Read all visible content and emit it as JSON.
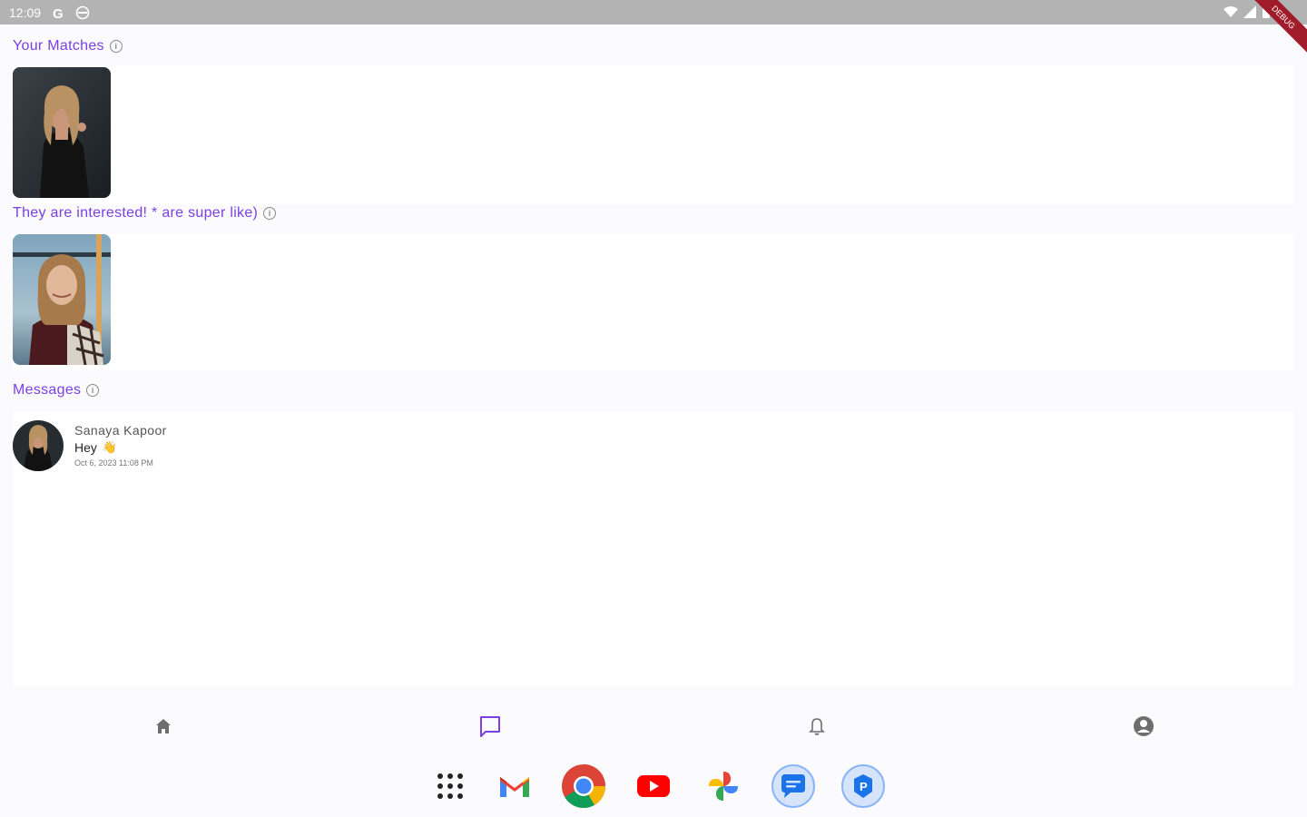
{
  "status_bar": {
    "time": "12:09"
  },
  "debug_banner": {
    "label": "DEBUG"
  },
  "sections": {
    "matches": {
      "title": "Your Matches"
    },
    "interested": {
      "title": "They are interested! * are super like)"
    },
    "messages": {
      "title": "Messages"
    }
  },
  "messages": [
    {
      "name": "Sanaya Kapoor",
      "text": "Hey",
      "emoji": "👋",
      "time": "Oct 6, 2023 11:08 PM"
    }
  ],
  "bottom_nav": {
    "items": [
      {
        "icon": "home-icon",
        "active": false
      },
      {
        "icon": "chat-icon",
        "active": true
      },
      {
        "icon": "bell-icon",
        "active": false
      },
      {
        "icon": "account-icon",
        "active": false
      }
    ],
    "active_color": "#7b3fe4",
    "inactive_color": "#6e6e6e"
  },
  "dock": {
    "apps": [
      "app-drawer-icon",
      "gmail-icon",
      "chrome-icon",
      "youtube-icon",
      "photos-icon",
      "messages-icon",
      "files-icon"
    ]
  },
  "colors": {
    "accent": "#7b3fe4",
    "background": "#fbfafd"
  }
}
